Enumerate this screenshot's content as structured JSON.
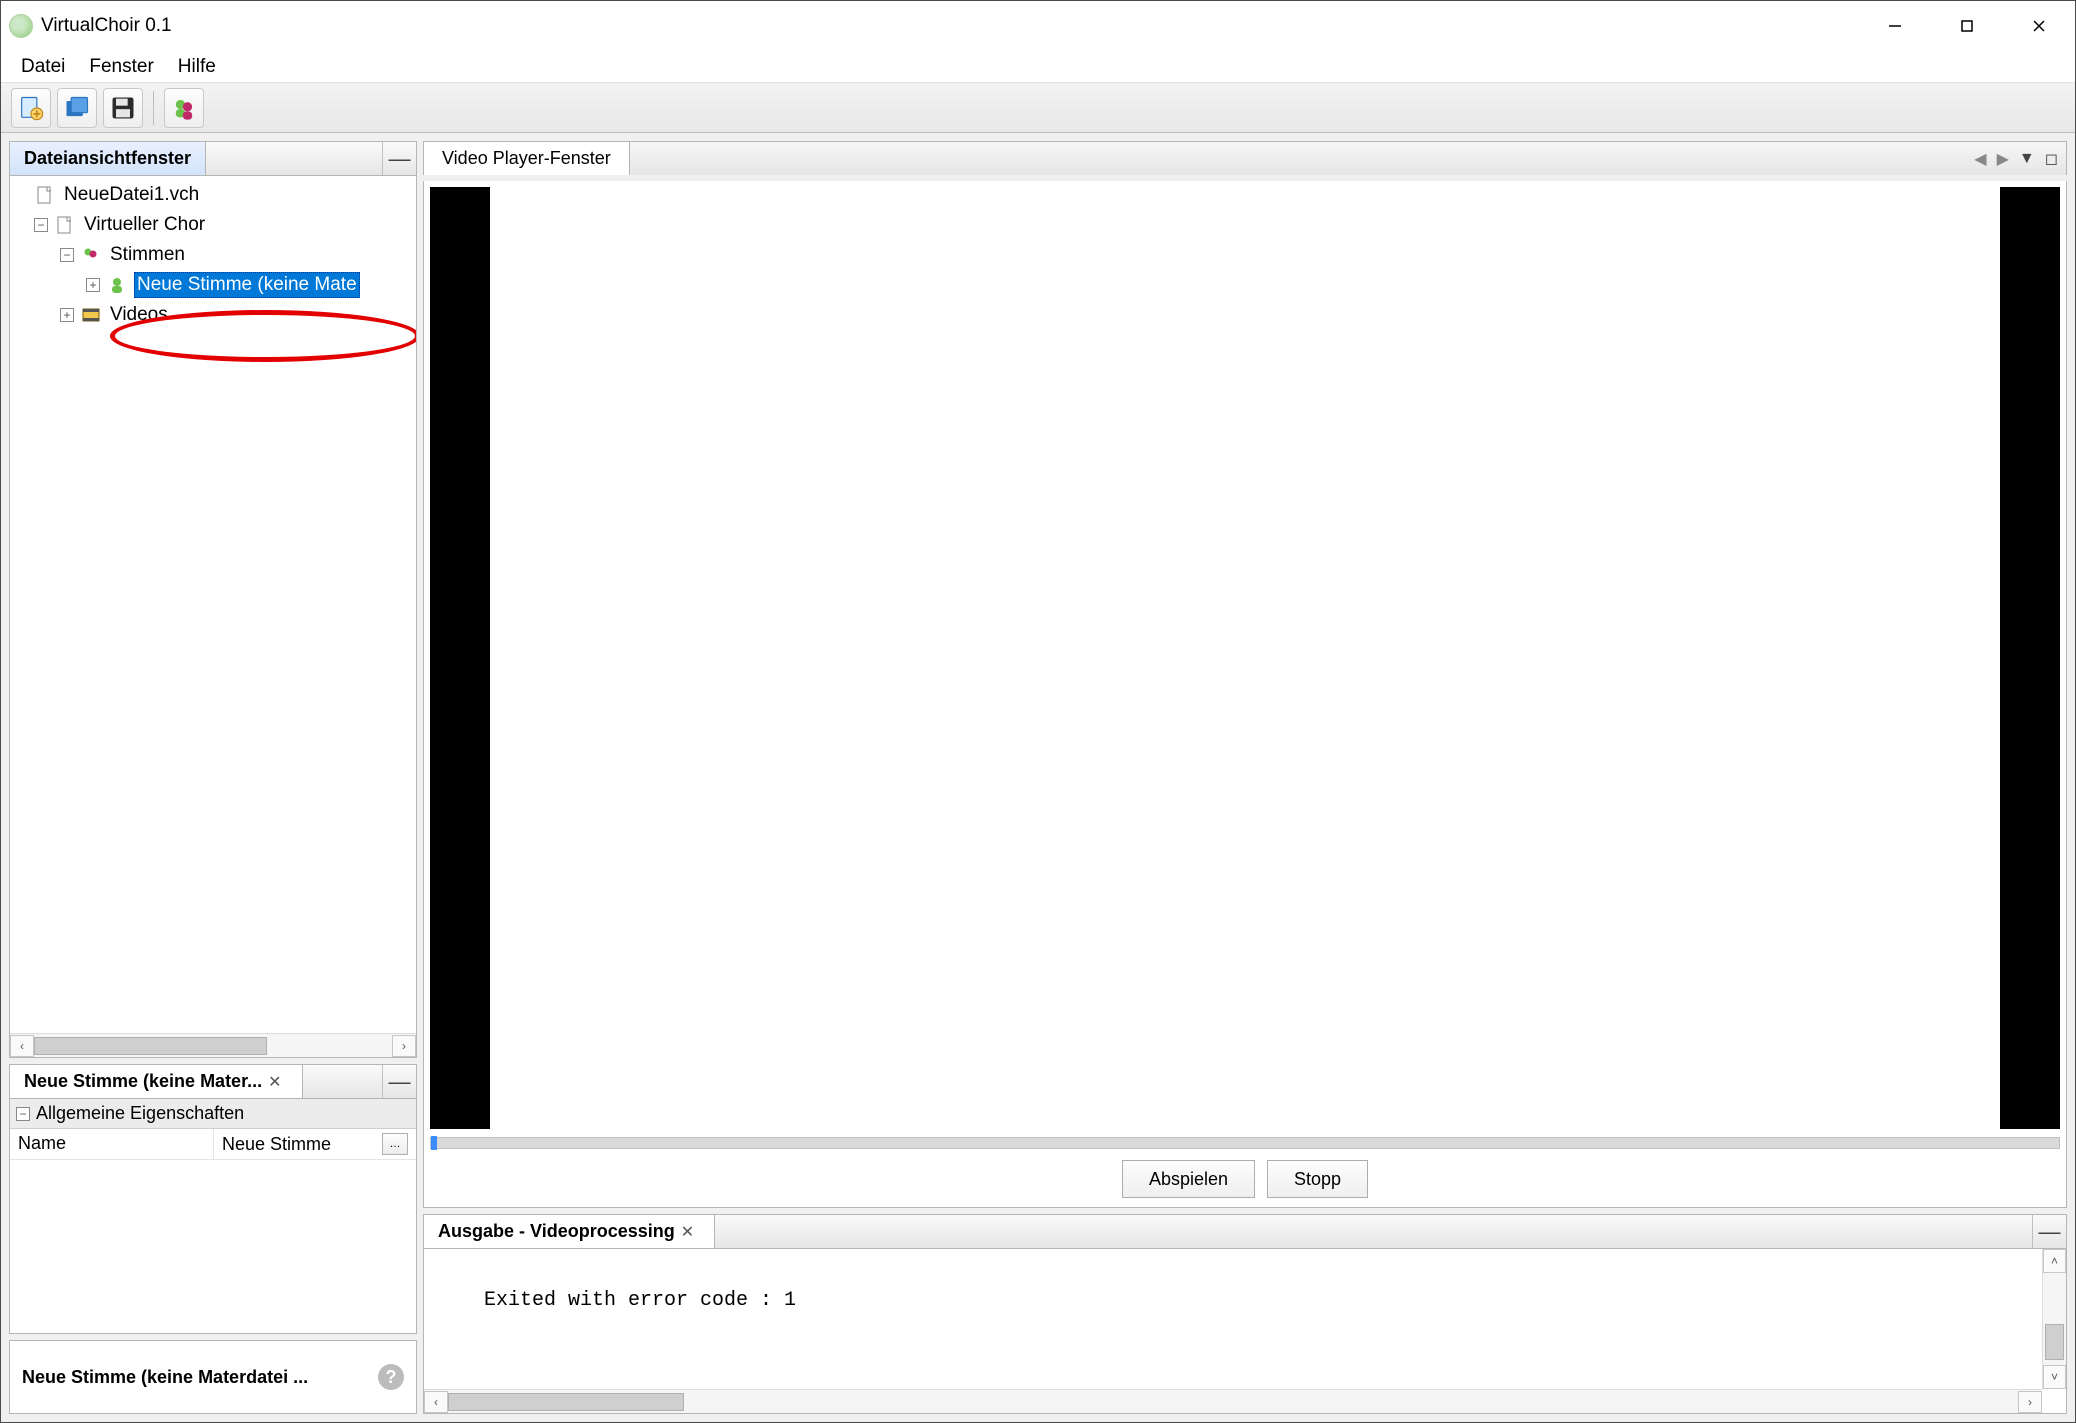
{
  "app": {
    "title": "VirtualChoir 0.1"
  },
  "menu": {
    "file": "Datei",
    "window": "Fenster",
    "help": "Hilfe"
  },
  "toolbar": {
    "new": "new-file-icon",
    "open": "open-file-icon",
    "save": "save-icon",
    "voices": "voices-icon"
  },
  "sidebar": {
    "tab_title": "Dateiansichtfenster",
    "tree": {
      "file": "NeueDatei1.vch",
      "root": "Virtueller Chor",
      "stimmen": "Stimmen",
      "new_voice": "Neue Stimme (keine Mate",
      "videos": "Videos"
    }
  },
  "properties": {
    "tab_title": "Neue Stimme (keine Mater...",
    "group": "Allgemeine Eigenschaften",
    "row_key": "Name",
    "row_value": "Neue Stimme"
  },
  "status": {
    "text": "Neue Stimme (keine Materdatei ..."
  },
  "video": {
    "tab_title": "Video Player-Fenster",
    "play": "Abspielen",
    "stop": "Stopp"
  },
  "output": {
    "tab_title": "Ausgabe - Videoprocessing",
    "text": "Exited with error code : 1"
  }
}
